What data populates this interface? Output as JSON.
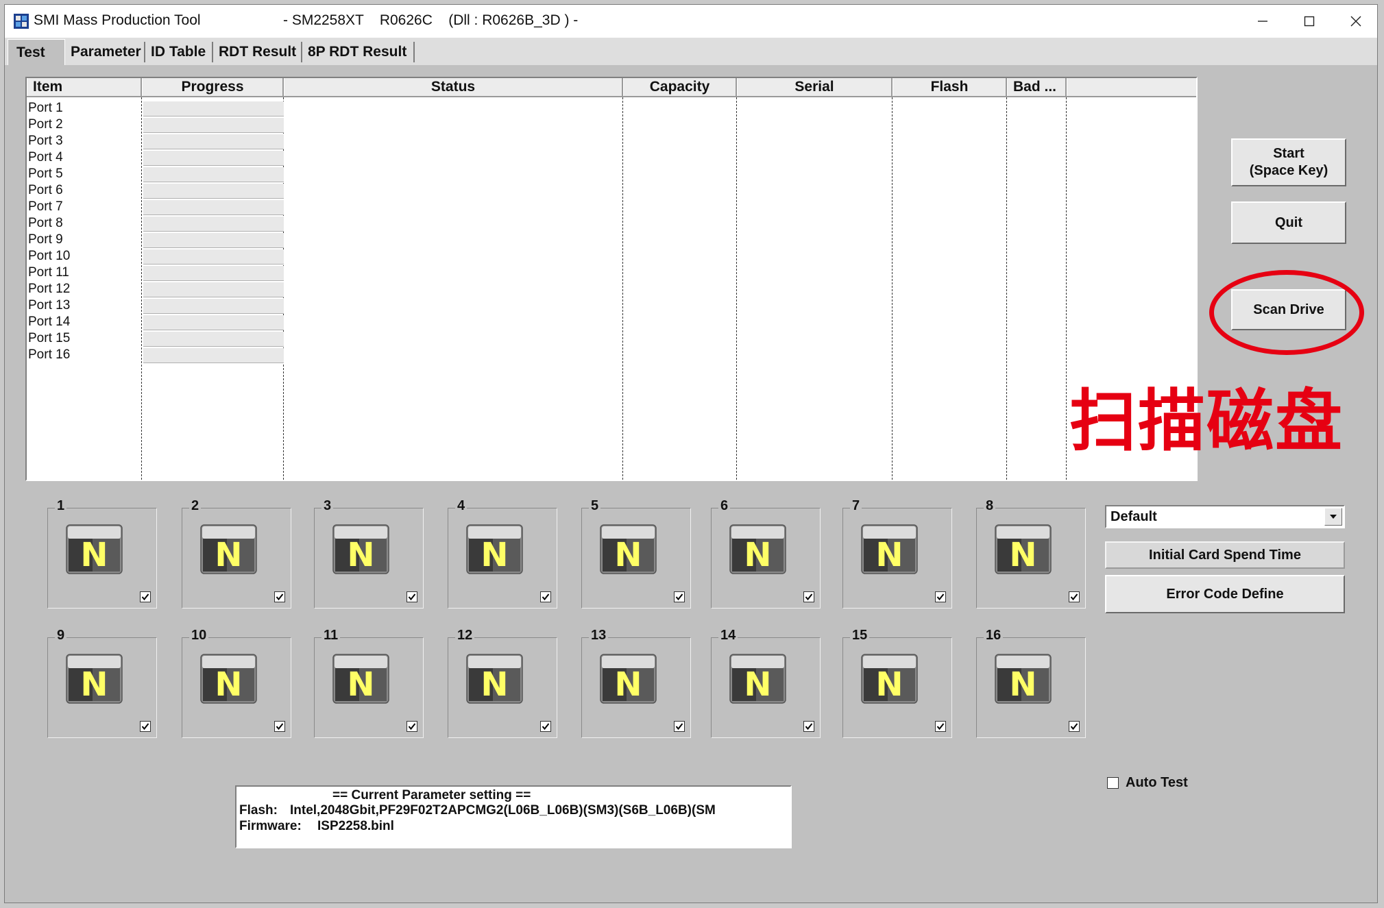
{
  "window": {
    "title": "SMI Mass Production Tool",
    "version_info": "- SM2258XT    R0626C    (Dll : R0626B_3D ) -",
    "controls": [
      "minimize-icon",
      "maximize-icon",
      "close-icon"
    ]
  },
  "tabs": [
    {
      "label": "Test",
      "active": true
    },
    {
      "label": "Parameter"
    },
    {
      "label": "ID Table"
    },
    {
      "label": "RDT Result"
    },
    {
      "label": "8P RDT Result"
    }
  ],
  "table": {
    "columns": [
      "Item",
      "Progress",
      "Status",
      "Capacity",
      "Serial",
      "Flash",
      "Bad ..."
    ],
    "rows": [
      "Port 1",
      "Port 2",
      "Port 3",
      "Port 4",
      "Port 5",
      "Port 6",
      "Port 7",
      "Port 8",
      "Port 9",
      "Port 10",
      "Port 11",
      "Port 12",
      "Port 13",
      "Port 14",
      "Port 15",
      "Port 16"
    ]
  },
  "buttons": {
    "start_line1": "Start",
    "start_line2": "(Space Key)",
    "quit": "Quit",
    "scan_drive": "Scan Drive",
    "initial_card": "Initial Card Spend Time",
    "error_code": "Error Code Define"
  },
  "annotation": {
    "text": "扫描磁盘",
    "color": "#e60012"
  },
  "ports": [
    {
      "num": "1",
      "state": "N",
      "checked": true
    },
    {
      "num": "2",
      "state": "N",
      "checked": true
    },
    {
      "num": "3",
      "state": "N",
      "checked": true
    },
    {
      "num": "4",
      "state": "N",
      "checked": true
    },
    {
      "num": "5",
      "state": "N",
      "checked": true
    },
    {
      "num": "6",
      "state": "N",
      "checked": true
    },
    {
      "num": "7",
      "state": "N",
      "checked": true
    },
    {
      "num": "8",
      "state": "N",
      "checked": true
    },
    {
      "num": "9",
      "state": "N",
      "checked": true
    },
    {
      "num": "10",
      "state": "N",
      "checked": true
    },
    {
      "num": "11",
      "state": "N",
      "checked": true
    },
    {
      "num": "12",
      "state": "N",
      "checked": true
    },
    {
      "num": "13",
      "state": "N",
      "checked": true
    },
    {
      "num": "14",
      "state": "N",
      "checked": true
    },
    {
      "num": "15",
      "state": "N",
      "checked": true
    },
    {
      "num": "16",
      "state": "N",
      "checked": true
    }
  ],
  "profile_select": {
    "value": "Default"
  },
  "auto_test": {
    "label": "Auto Test",
    "checked": false
  },
  "params": {
    "header": "== Current Parameter setting ==",
    "flash_label": "Flash:",
    "flash_value": "Intel,2048Gbit,PF29F02T2APCMG2(L06B_L06B)(SM3)(S6B_L06B)(SM",
    "firmware_label": "Firmware:",
    "firmware_value": "ISP2258.binl"
  },
  "colors": {
    "accent_red": "#e60012",
    "port_letter": "#ffff66",
    "window_bg": "#c0c0c0"
  }
}
